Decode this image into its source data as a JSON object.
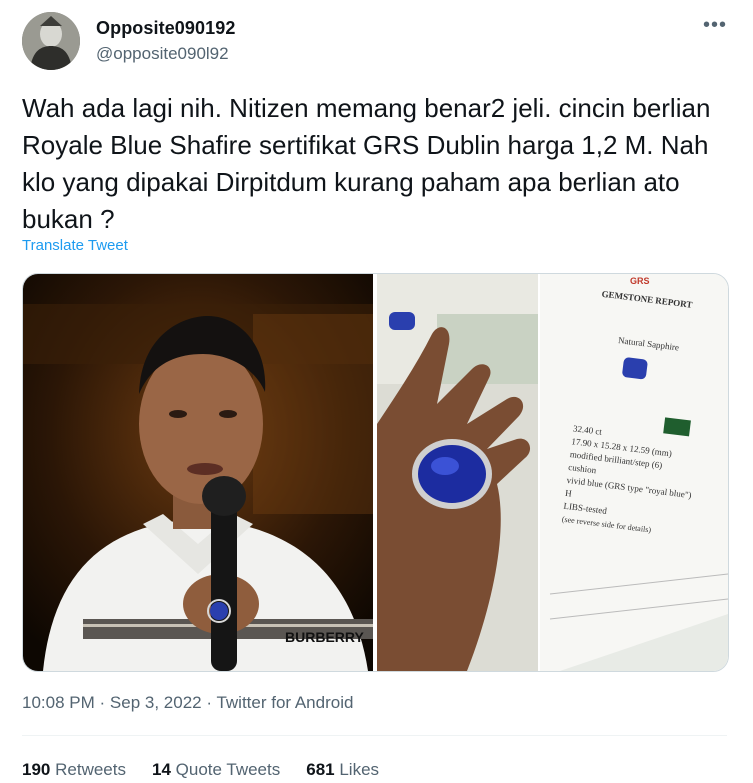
{
  "author": {
    "display_name": "Opposite090192",
    "handle": "@opposite090l92",
    "avatar_icon": "profile-avatar"
  },
  "more_icon": "more-dots-icon",
  "tweet": {
    "text": "Wah ada lagi nih. Nitizen memang benar2 jeli. cincin berlian Royale Blue Shafire sertifikat GRS Dublin harga 1,2 M. Nah klo yang dipakai Dirpitdum kurang paham apa berlian ato bukan ?",
    "translate_label": "Translate Tweet"
  },
  "media": {
    "photo1": {
      "shirt_brand": "BURBERRY"
    },
    "photo3": {
      "lines": [
        "GEMSTONE REPORT",
        "Natural Sapphire",
        "32.40 ct",
        "17.90 x 15.28 x 12.59 (mm)",
        "modified brilliant/step (6)",
        "cushion",
        "vivid blue (GRS type \"royal blue\")",
        "H",
        "LIBS-tested",
        "(see reverse side for details)"
      ],
      "logo": "GRS"
    }
  },
  "meta": {
    "time": "10:08 PM",
    "separator": "·",
    "date": "Sep 3, 2022",
    "source": "Twitter for Android"
  },
  "stats": {
    "retweets_count": "190",
    "retweets_label": "Retweets",
    "quotes_count": "14",
    "quotes_label": "Quote Tweets",
    "likes_count": "681",
    "likes_label": "Likes"
  },
  "colors": {
    "link": "#1d9bf0",
    "secondary_text": "#536471",
    "primary_text": "#0f1419"
  }
}
